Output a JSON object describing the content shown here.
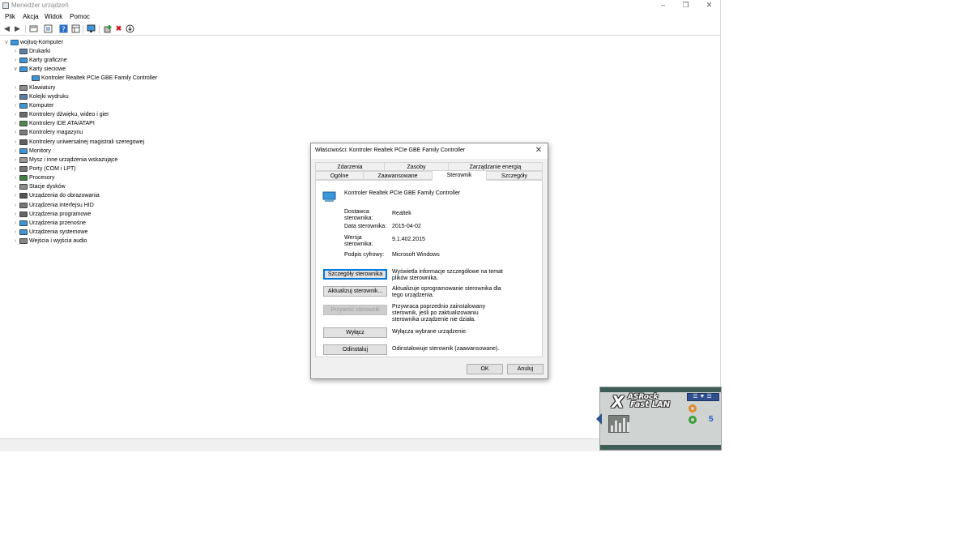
{
  "window": {
    "title": "Menedżer urządzeń",
    "controls": {
      "minimize": "–",
      "maximize": "❐",
      "close": "✕"
    }
  },
  "menubar": [
    "Plik",
    "Akcja",
    "Widok",
    "Pomoc"
  ],
  "toolbar": {
    "icons": [
      "back-icon",
      "forward-icon",
      "properties-view-icon",
      "driver-view-icon",
      "help-icon",
      "grid-view-icon",
      "monitor-icon",
      "add-driver-icon",
      "uninstall-icon",
      "update-icon"
    ],
    "uninstall_glyph": "✖",
    "help_glyph": "?"
  },
  "tree": {
    "root": "wojtuq-Komputer",
    "items": [
      {
        "label": "Drukarki",
        "icon": "printer-icon",
        "expanded": false
      },
      {
        "label": "Karty graficzne",
        "icon": "display-adapter-icon",
        "expanded": false
      },
      {
        "label": "Karty sieciowe",
        "icon": "network-adapter-icon",
        "expanded": true
      },
      {
        "label": "Kontroler Realtek PCIe GBE Family Controller",
        "icon": "network-adapter-icon",
        "child": true
      },
      {
        "label": "Klawiatury",
        "icon": "keyboard-icon",
        "expanded": false
      },
      {
        "label": "Kolejki wydruku",
        "icon": "print-queue-icon",
        "expanded": false
      },
      {
        "label": "Komputer",
        "icon": "computer-icon",
        "expanded": false
      },
      {
        "label": "Kontrolery dźwięku, wideo i gier",
        "icon": "sound-icon",
        "expanded": false
      },
      {
        "label": "Kontrolery IDE ATA/ATAPI",
        "icon": "ide-icon",
        "expanded": false
      },
      {
        "label": "Kontrolery magazynu",
        "icon": "storage-icon",
        "expanded": false
      },
      {
        "label": "Kontrolery uniwersalnej magistrali szeregowej",
        "icon": "usb-icon",
        "expanded": false
      },
      {
        "label": "Monitory",
        "icon": "monitor-icon",
        "expanded": false
      },
      {
        "label": "Mysz i inne urządzenia wskazujące",
        "icon": "mouse-icon",
        "expanded": false
      },
      {
        "label": "Porty (COM i LPT)",
        "icon": "port-icon",
        "expanded": false
      },
      {
        "label": "Procesory",
        "icon": "cpu-icon",
        "expanded": false
      },
      {
        "label": "Stacje dysków",
        "icon": "disk-icon",
        "expanded": false
      },
      {
        "label": "Urządzenia do obrazowania",
        "icon": "camera-icon",
        "expanded": false
      },
      {
        "label": "Urządzenia interfejsu HID",
        "icon": "hid-icon",
        "expanded": false
      },
      {
        "label": "Urządzenia programowe",
        "icon": "software-device-icon",
        "expanded": false
      },
      {
        "label": "Urządzenia przenośne",
        "icon": "portable-device-icon",
        "expanded": false
      },
      {
        "label": "Urządzenia systemowe",
        "icon": "system-device-icon",
        "expanded": false
      },
      {
        "label": "Wejścia i wyjścia audio",
        "icon": "audio-io-icon",
        "expanded": false
      }
    ]
  },
  "dialog": {
    "title": "Właściwości: Kontroler Realtek PCIe GBE Family Controller",
    "close": "✕",
    "tabs_row1": [
      "Zdarzenia",
      "Zasoby",
      "Zarządzanie energią"
    ],
    "tabs_row2": [
      "Ogólne",
      "Zaawansowane",
      "Sterownik",
      "Szczegóły"
    ],
    "active_tab": "Sterownik",
    "device_name": "Kontroler Realtek PCIe GBE Family Controller",
    "fields": [
      {
        "label": "Dostawca sterownika:",
        "value": "Realtek"
      },
      {
        "label": "Data sterownika:",
        "value": "2015-04-02"
      },
      {
        "label": "Wersja sterownika:",
        "value": "9.1.402.2015"
      },
      {
        "label": "Podpis cyfrowy:",
        "value": "Microsoft Windows"
      }
    ],
    "actions": [
      {
        "button": "Szczegóły sterownika",
        "desc": "Wyświetla informacje szczegółowe na temat plików sterownika.",
        "state": "focus"
      },
      {
        "button": "Aktualizuj sterownik...",
        "desc": "Aktualizuje oprogramowanie sterownika dla tego urządzenia.",
        "state": "normal"
      },
      {
        "button": "Przywróć sterownik",
        "desc": "Przywraca poprzednio zainstalowany sterownik, jeśli po zaktualizowaniu sterownika urządzenie nie działa.",
        "state": "disabled"
      },
      {
        "button": "Wyłącz",
        "desc": "Wyłącza wybrane urządzenie.",
        "state": "normal"
      },
      {
        "button": "Odinstaluj",
        "desc": "Odinstalowuje sterownik (zaawansowane).",
        "state": "normal"
      }
    ],
    "ok": "OK",
    "cancel": "Anuluj"
  },
  "widget": {
    "logo_x": "X",
    "logo_brand": "ASRock",
    "logo_product": "Fast LAN",
    "menu_glyph": "☰▼☰",
    "count": "5",
    "colors": {
      "frame": "#3f5d57",
      "accent": "#2f4f8f",
      "count": "#1a56c4"
    }
  },
  "colors": {
    "focus": "#0078d7",
    "network_icon": "#3a96dd"
  }
}
